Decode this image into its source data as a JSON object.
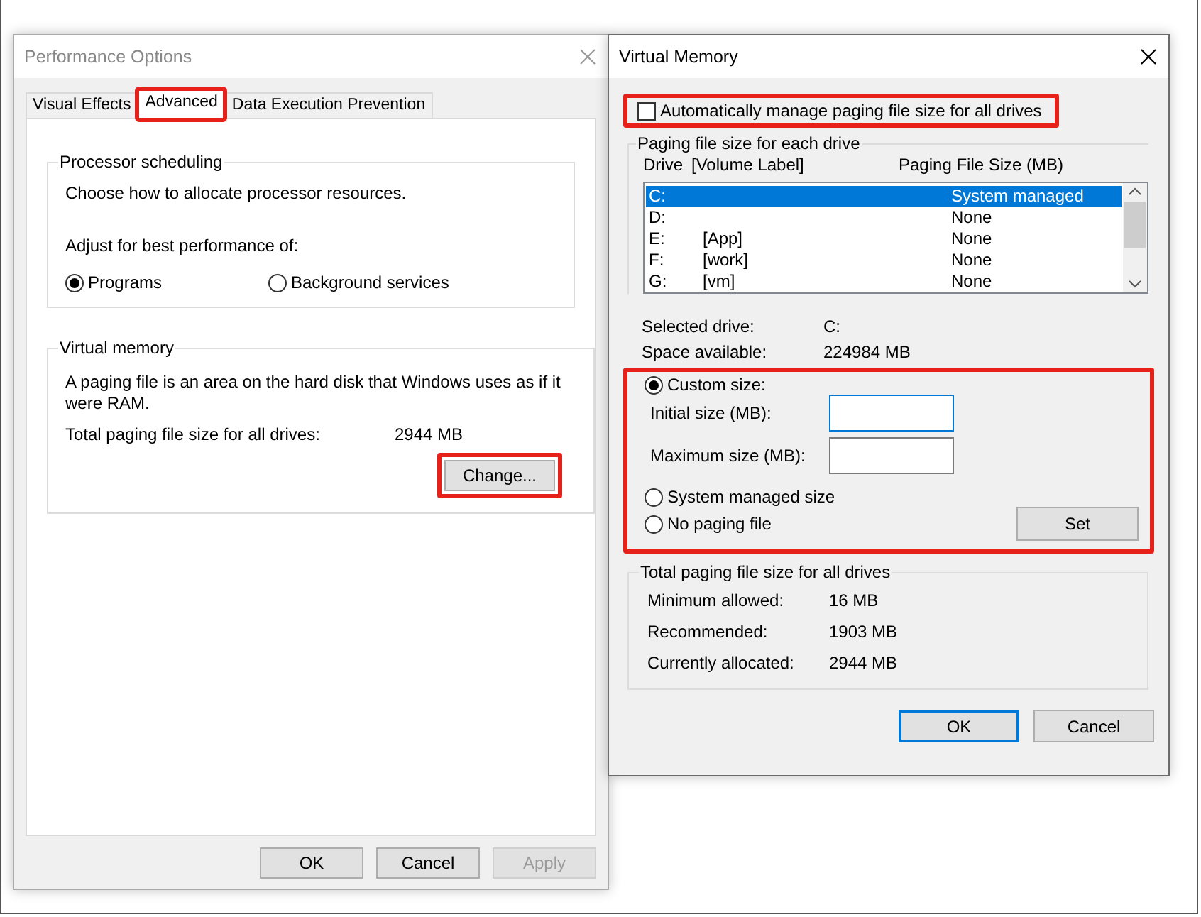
{
  "performance_options": {
    "title": "Performance Options",
    "tabs": [
      {
        "label": "Visual Effects",
        "selected": false,
        "highlighted": false
      },
      {
        "label": "Advanced",
        "selected": true,
        "highlighted": true
      },
      {
        "label": "Data Execution Prevention",
        "selected": false,
        "highlighted": false
      }
    ],
    "processor_scheduling": {
      "title": "Processor scheduling",
      "description": "Choose how to allocate processor resources.",
      "adjust_label": "Adjust for best performance of:",
      "options": [
        {
          "label": "Programs",
          "selected": true
        },
        {
          "label": "Background services",
          "selected": false
        }
      ]
    },
    "virtual_memory": {
      "title": "Virtual memory",
      "description": "A paging file is an area on the hard disk that Windows uses as if it were RAM.",
      "total_label": "Total paging file size for all drives:",
      "total_value": "2944 MB",
      "change_button": {
        "label": "Change...",
        "highlighted": true
      }
    },
    "buttons": [
      {
        "label": "OK",
        "disabled": false
      },
      {
        "label": "Cancel",
        "disabled": false
      },
      {
        "label": "Apply",
        "disabled": true
      }
    ]
  },
  "virtual_memory_dialog": {
    "title": "Virtual Memory",
    "auto_manage": {
      "label": "Automatically manage paging file size for all drives",
      "checked": false,
      "highlighted": true
    },
    "drives": {
      "title": "Paging file size for each drive",
      "columns": [
        "Drive",
        "[Volume Label]",
        "Paging File Size (MB)"
      ],
      "rows": [
        {
          "drive": "C:",
          "label": "",
          "size": "System managed",
          "selected": true
        },
        {
          "drive": "D:",
          "label": "",
          "size": "None",
          "selected": false
        },
        {
          "drive": "E:",
          "label": "[App]",
          "size": "None",
          "selected": false
        },
        {
          "drive": "F:",
          "label": "[work]",
          "size": "None",
          "selected": false
        },
        {
          "drive": "G:",
          "label": "[vm]",
          "size": "None",
          "selected": false
        }
      ],
      "info": [
        {
          "label": "Selected drive:",
          "value": "C:"
        },
        {
          "label": "Space available:",
          "value": "224984 MB"
        }
      ],
      "size_section": {
        "highlighted": true,
        "custom": {
          "label": "Custom size:",
          "selected": true
        },
        "fields": [
          {
            "label": "Initial size (MB):",
            "focused": true
          },
          {
            "label": "Maximum size (MB):",
            "focused": false
          }
        ],
        "others": [
          {
            "label": "System managed size",
            "selected": false
          },
          {
            "label": "No paging file",
            "selected": false
          }
        ],
        "set_button": "Set"
      }
    },
    "totals": {
      "title": "Total paging file size for all drives",
      "rows": [
        {
          "label": "Minimum allowed:",
          "value": "16 MB"
        },
        {
          "label": "Recommended:",
          "value": "1903 MB"
        },
        {
          "label": "Currently allocated:",
          "value": "2944 MB"
        }
      ]
    },
    "buttons": [
      {
        "label": "OK",
        "default": true
      },
      {
        "label": "Cancel",
        "default": false
      }
    ]
  }
}
